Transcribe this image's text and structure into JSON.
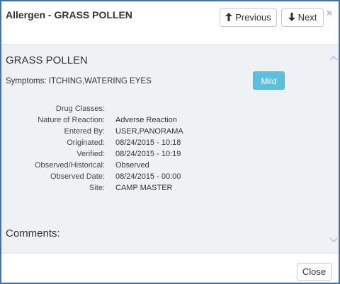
{
  "dialog": {
    "title": "Allergen - GRASS POLLEN",
    "previous_label": "Previous",
    "next_label": "Next",
    "close_x": "×",
    "close_label": "Close"
  },
  "allergen": {
    "name": "GRASS POLLEN",
    "symptoms": "Symptoms: ITCHING,WATERING EYES",
    "severity": "Mild"
  },
  "details": [
    {
      "label": "Drug Classes:",
      "value": ""
    },
    {
      "label": "Nature of Reaction:",
      "value": "Adverse Reaction"
    },
    {
      "label": "Entered By:",
      "value": "USER,PANORAMA"
    },
    {
      "label": "Originated:",
      "value": "08/24/2015 - 10:18"
    },
    {
      "label": "Verified:",
      "value": "08/24/2015 - 10:19"
    },
    {
      "label": "Observed/Historical:",
      "value": "Observed"
    },
    {
      "label": "Observed Date:",
      "value": "08/24/2015 - 00:00"
    },
    {
      "label": "Site:",
      "value": "CAMP MASTER"
    }
  ],
  "comments_heading": "Comments:",
  "colors": {
    "border": "#4a6fa5",
    "body_bg": "#eef2f5",
    "severity_bg": "#5bc0de"
  }
}
